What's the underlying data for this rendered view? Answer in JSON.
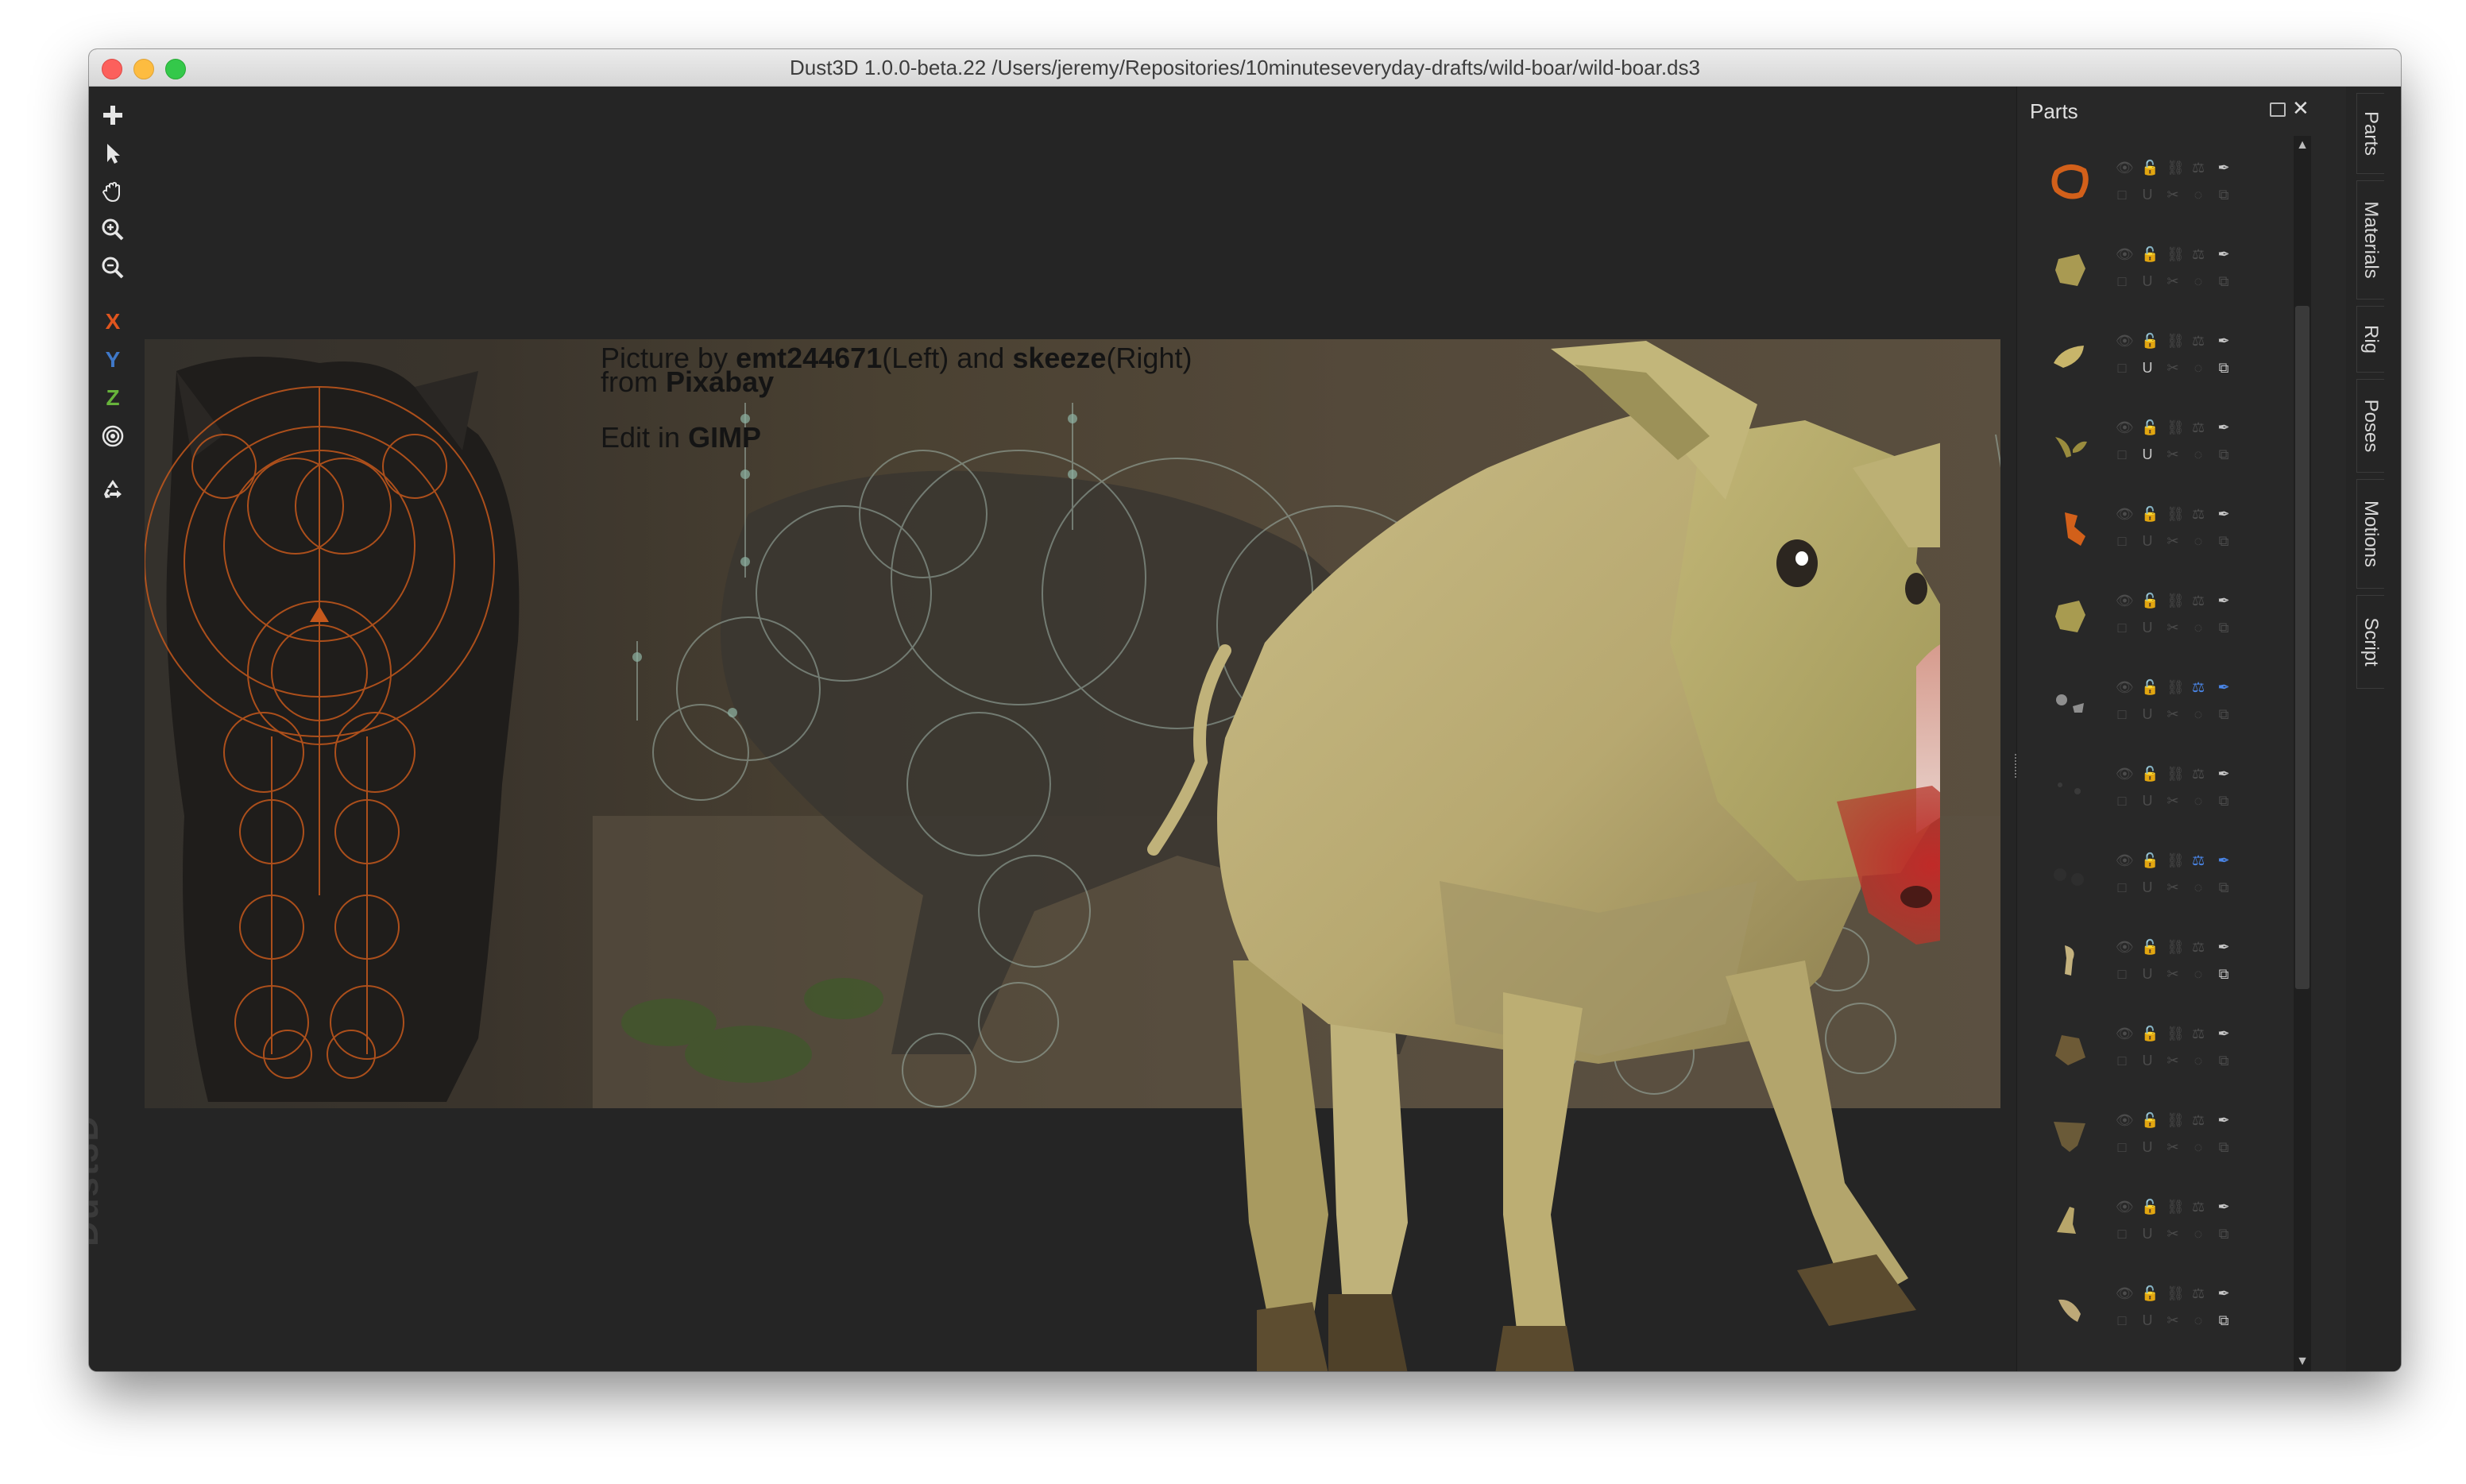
{
  "window": {
    "title": "Dust3D 1.0.0-beta.22 /Users/jeremy/Repositories/10minuteseveryday-drafts/wild-boar/wild-boar.ds3"
  },
  "toolbar": {
    "tools": [
      {
        "name": "add-icon",
        "glyph": "+"
      },
      {
        "name": "select-icon",
        "glyph": "pointer"
      },
      {
        "name": "pan-hand-icon",
        "glyph": "hand"
      },
      {
        "name": "zoom-in-icon",
        "glyph": "zoom-in"
      },
      {
        "name": "zoom-out-icon",
        "glyph": "zoom-out"
      }
    ],
    "axes": {
      "x": "X",
      "y": "Y",
      "z": "Z"
    },
    "radial_icon": "target-icon",
    "recycle_icon": "recycle-icon",
    "colors": {
      "x": "#e0551e",
      "y": "#3f78c8",
      "z": "#67b33b"
    }
  },
  "watermark": "Dust3D",
  "reference_image": {
    "caption_prefix": "Picture by ",
    "author_left": "emt244671",
    "left_suffix": "(Left) and ",
    "author_right": "skeeze",
    "right_suffix": "(Right)",
    "from_prefix": "from ",
    "source": "Pixabay",
    "edit_prefix": "Edit in ",
    "editor": "GIMP"
  },
  "parts_panel": {
    "title": "Parts",
    "parts": [
      {
        "shape": "ring",
        "color": "#d2601a",
        "blue": false
      },
      {
        "shape": "blob",
        "color": "#a99a52",
        "blue": false
      },
      {
        "shape": "leaf",
        "color": "#c8b56a",
        "blue": false
      },
      {
        "shape": "sprout",
        "color": "#9a8c3e",
        "blue": false
      },
      {
        "shape": "hook",
        "color": "#d2601a",
        "blue": false
      },
      {
        "shape": "blob",
        "color": "#a89b50",
        "blue": false
      },
      {
        "shape": "pair",
        "color": "#8e8e8e",
        "blue": true
      },
      {
        "shape": "dots",
        "color": "#3a3a3a",
        "blue": false
      },
      {
        "shape": "dots2",
        "color": "#2e2e2e",
        "blue": true
      },
      {
        "shape": "tusk",
        "color": "#c4b27e",
        "blue": false
      },
      {
        "shape": "rock",
        "color": "#6d5a36",
        "blue": false
      },
      {
        "shape": "hoof",
        "color": "#6a5a38",
        "blue": false
      },
      {
        "shape": "foot",
        "color": "#b8a66a",
        "blue": false
      },
      {
        "shape": "ear",
        "color": "#bda978",
        "blue": false
      },
      {
        "shape": "blob",
        "color": "#7a6a40",
        "blue": false
      }
    ]
  },
  "side_tabs": [
    "Parts",
    "Materials",
    "Rig",
    "Poses",
    "Motions",
    "Script"
  ]
}
